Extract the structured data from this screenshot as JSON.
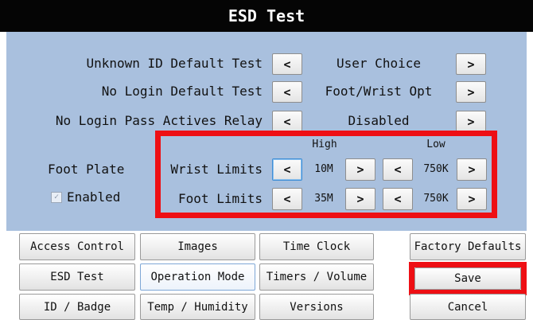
{
  "title": "ESD Test",
  "settings": [
    {
      "label": "Unknown ID Default Test",
      "prev": "<",
      "value": "User Choice",
      "next": ">"
    },
    {
      "label": "No Login Default Test",
      "prev": "<",
      "value": "Foot/Wrist Opt",
      "next": ">"
    },
    {
      "label": "No Login Pass Actives Relay",
      "prev": "<",
      "value": "Disabled",
      "next": ">"
    }
  ],
  "foot_plate": {
    "label": "Foot Plate",
    "enabled_label": "Enabled",
    "enabled": true
  },
  "limits": {
    "high_header": "High",
    "low_header": "Low",
    "wrist": {
      "label": "Wrist Limits",
      "high": "10M",
      "low": "750K"
    },
    "foot": {
      "label": "Foot Limits",
      "high": "35M",
      "low": "750K"
    },
    "dec": "<",
    "inc": ">"
  },
  "nav": {
    "access_control": "Access Control",
    "images": "Images",
    "time_clock": "Time Clock",
    "factory_defaults": "Factory Defaults",
    "esd_test": "ESD Test",
    "operation_mode": "Operation Mode",
    "timers_volume": "Timers / Volume",
    "save": "Save",
    "id_badge": "ID / Badge",
    "temp_humidity": "Temp / Humidity",
    "versions": "Versions",
    "cancel": "Cancel"
  },
  "colors": {
    "panel": "#a9c0de",
    "titlebar": "#050505",
    "highlight": "#ee0f14"
  }
}
